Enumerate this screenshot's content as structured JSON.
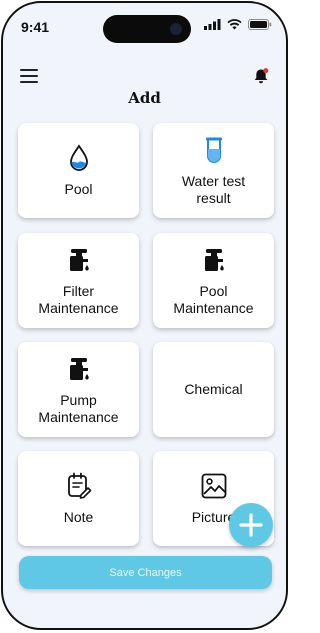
{
  "status": {
    "time": "9:41"
  },
  "header": {
    "title": "Add"
  },
  "cards": [
    {
      "label": "Pool",
      "icon": "water-drop-icon"
    },
    {
      "label": "Water test\nresult",
      "icon": "test-tube-icon"
    },
    {
      "label": "Filter\nMaintenance",
      "icon": "faucet-icon"
    },
    {
      "label": "Pool\nMaintenance",
      "icon": "faucet-icon"
    },
    {
      "label": "Pump\nMaintenance",
      "icon": "faucet-icon"
    },
    {
      "label": "Chemical",
      "icon": ""
    },
    {
      "label": "Note",
      "icon": "note-icon"
    },
    {
      "label": "Picture",
      "icon": "image-icon"
    }
  ],
  "footer": {
    "save_label": "Save Changes"
  },
  "colors": {
    "accent": "#5fc8e4",
    "background": "#f1f4fb",
    "notification": "#e53935"
  }
}
